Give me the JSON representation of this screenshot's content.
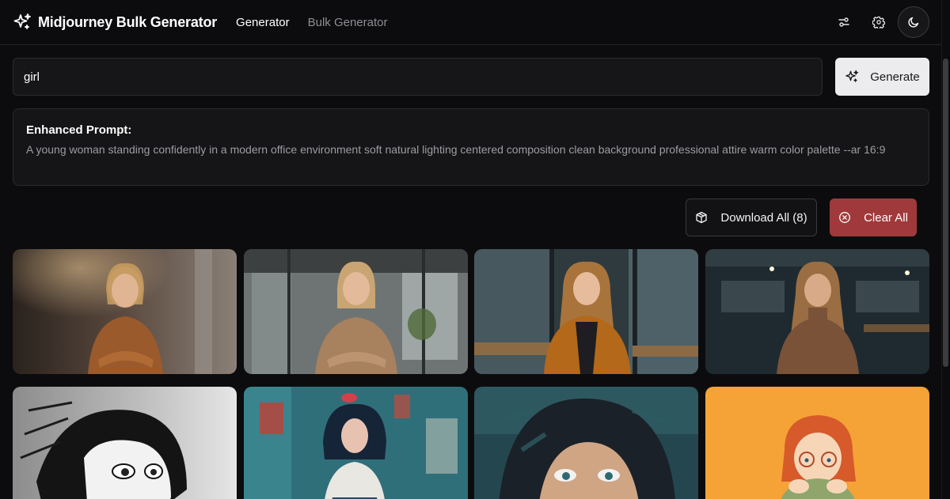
{
  "header": {
    "brand_title": "Midjourney Bulk Generator",
    "nav": [
      {
        "label": "Generator",
        "active": true
      },
      {
        "label": "Bulk Generator",
        "active": false
      }
    ],
    "icons": [
      "sliders-icon",
      "gear-icon",
      "moon-icon"
    ]
  },
  "search": {
    "value": "girl",
    "generate_label": "Generate"
  },
  "enhanced": {
    "title": "Enhanced Prompt:",
    "text": "A young woman standing confidently in a modern office environment soft natural lighting centered composition clean background professional attire warm color palette --ar 16:9"
  },
  "actions": {
    "download_label": "Download All (8)",
    "clear_label": "Clear All"
  },
  "colors": {
    "background": "#0c0c0e",
    "clear_button": "#a0393b",
    "generate_button": "#ececee"
  },
  "images": [
    {
      "subject": "woman-office-sweater",
      "palette": [
        "#3b2f28",
        "#6a5546",
        "#a06a3e"
      ]
    },
    {
      "subject": "woman-office-glass",
      "palette": [
        "#4b4d4e",
        "#8a8f90",
        "#a27b58"
      ]
    },
    {
      "subject": "woman-office-jacket",
      "palette": [
        "#2d3336",
        "#5a6a70",
        "#b06a1c"
      ]
    },
    {
      "subject": "woman-office-turtleneck",
      "palette": [
        "#1f2a2f",
        "#3e4e55",
        "#8a5a3a"
      ]
    },
    {
      "subject": "anime-sketch-bw",
      "palette": [
        "#7a7a7a",
        "#d8d8d8",
        "#111111"
      ]
    },
    {
      "subject": "painted-girl-teal",
      "palette": [
        "#2d6b78",
        "#b8433b",
        "#1d2a3a"
      ]
    },
    {
      "subject": "oil-painting-face",
      "palette": [
        "#1e3a44",
        "#3b6b6e",
        "#c49a7a"
      ]
    },
    {
      "subject": "cartoon-girl-orange",
      "palette": [
        "#f5a03a",
        "#e06b3a",
        "#8fa56b"
      ]
    }
  ]
}
